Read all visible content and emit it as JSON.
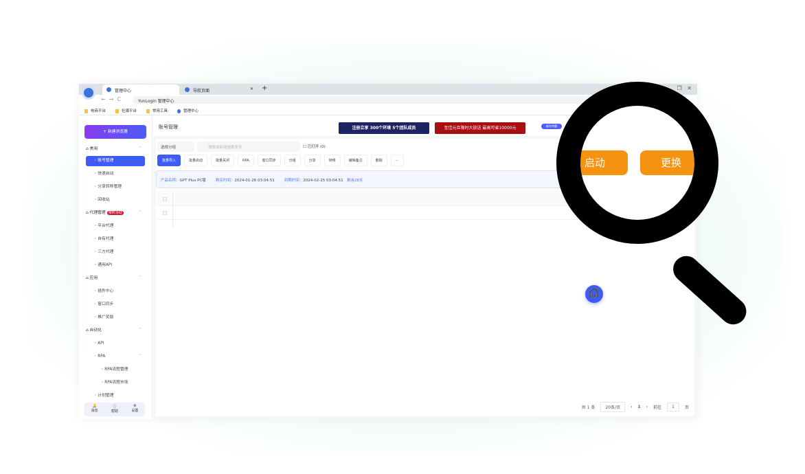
{
  "browser": {
    "tabs": [
      {
        "label": "管理中心",
        "active": true
      },
      {
        "label": "导航页面",
        "active": false
      }
    ],
    "url": "YunLogin 管理中心",
    "bookmarks": [
      "电商平台",
      "社媒平台",
      "常用工具",
      "管理中心"
    ]
  },
  "sidebar": {
    "new_button": "+ 新建浏览器",
    "items": [
      {
        "label": "常用",
        "level": 0
      },
      {
        "label": "账号管理",
        "level": 1,
        "active": true
      },
      {
        "label": "快速启动",
        "level": 1
      },
      {
        "label": "分享转移管理",
        "level": 1
      },
      {
        "label": "回收站",
        "level": 1
      },
      {
        "label": "代理管理",
        "level": 0,
        "badge": "限时活动"
      },
      {
        "label": "平台代理",
        "level": 1
      },
      {
        "label": "自有代理",
        "level": 1
      },
      {
        "label": "三方代理",
        "level": 1
      },
      {
        "label": "通用API",
        "level": 1
      },
      {
        "label": "应用",
        "level": 0
      },
      {
        "label": "插件中心",
        "level": 1
      },
      {
        "label": "窗口同步",
        "level": 1
      },
      {
        "label": "推广奖励",
        "level": 1
      },
      {
        "label": "自动化",
        "level": 0
      },
      {
        "label": "API",
        "level": 1
      },
      {
        "label": "RPA",
        "level": 1
      },
      {
        "label": "RPA流程管理",
        "level": 2
      },
      {
        "label": "RPA流程市场",
        "level": 2
      },
      {
        "label": "计划管理",
        "level": 1
      }
    ],
    "footer": [
      "消息",
      "帮助",
      "设置"
    ]
  },
  "header": {
    "title": "账号管理",
    "banner1": "注册立享 300个环境 5个团队成员",
    "banner2": "至佳元旦限时大放送 最高可省10000元",
    "banner3": "新年特惠"
  },
  "filter": {
    "group_select": "选择分组",
    "search_placeholder": "搜索或新建搜索条件",
    "opened_label": "已打开",
    "opened_count": "(0)"
  },
  "toolbar": [
    "批量导入",
    "批量启动",
    "批量关闭",
    "RPA",
    "窗口同步",
    "分组",
    "分享",
    "转移",
    "编辑备注",
    "删除",
    "···"
  ],
  "info": {
    "product_key": "产品名称：",
    "product": "GPT Plus PC版",
    "buy_key": "购买时间：",
    "buy": "2024-01-26 03:04:51",
    "exp_key": "到期时间：",
    "exp": "2024-02-25 03:04:51",
    "remain": "剩余28天"
  },
  "magnified": {
    "start": "启动",
    "replace": "更换"
  },
  "pager": {
    "total": "共 1 条",
    "size": "20条/页",
    "page": "1",
    "goto": "前往",
    "goto_val": "1",
    "unit": "页"
  },
  "colors": {
    "accent": "#3c5cf5",
    "orange": "#f5920f"
  }
}
